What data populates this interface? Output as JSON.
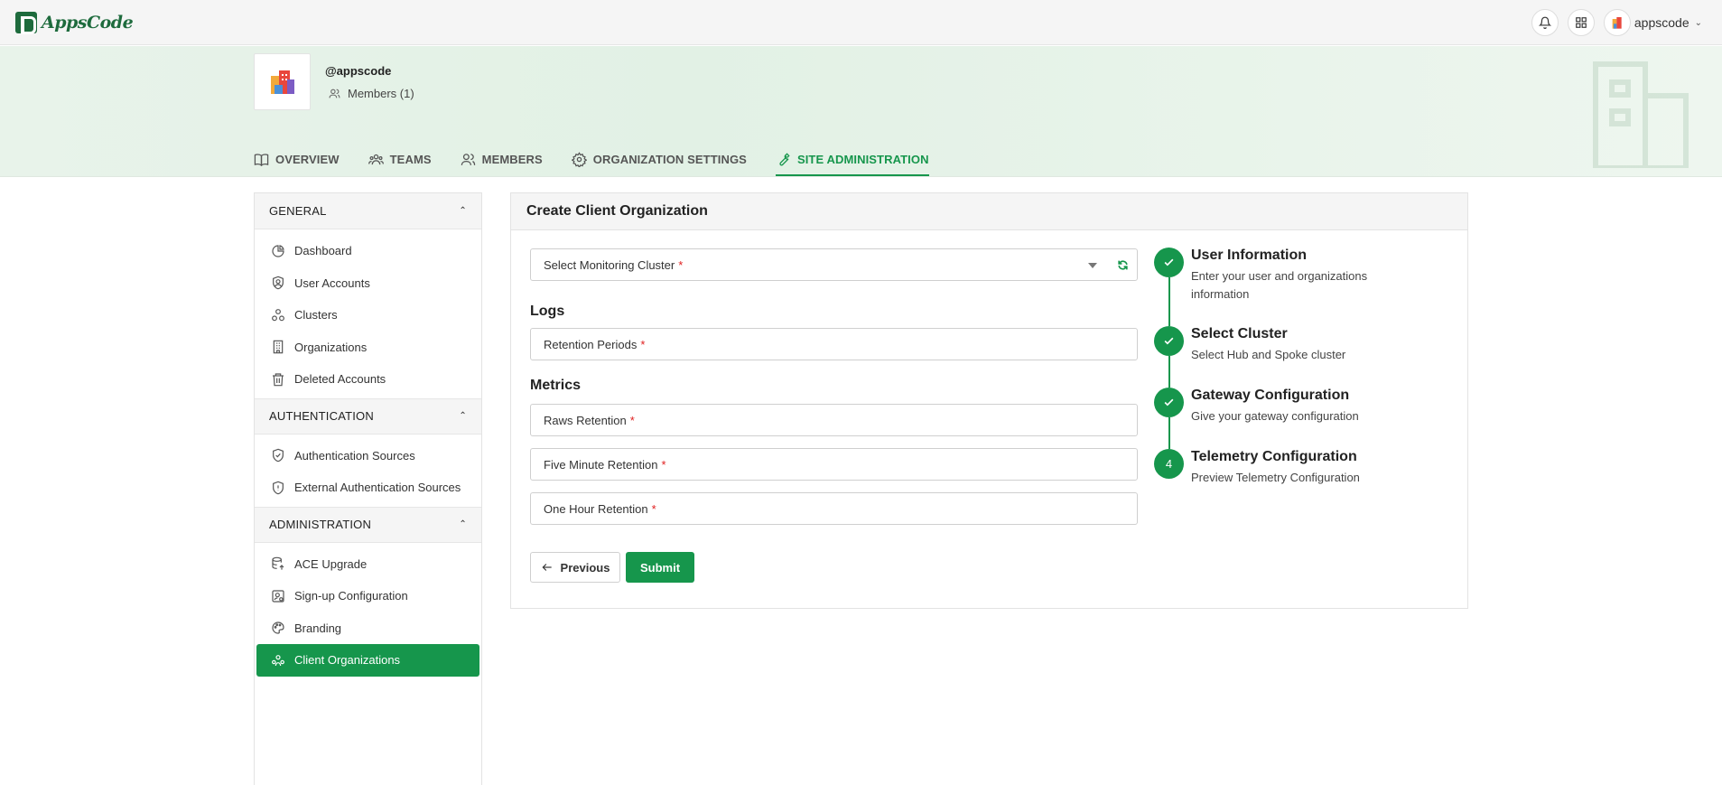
{
  "app": {
    "brand": "AppsCode",
    "user": "appscode"
  },
  "org": {
    "handle": "@appscode",
    "members": "Members (1)"
  },
  "tabs": [
    {
      "label": "OVERVIEW",
      "icon": "book-icon"
    },
    {
      "label": "TEAMS",
      "icon": "teams-icon"
    },
    {
      "label": "MEMBERS",
      "icon": "members-icon"
    },
    {
      "label": "ORGANIZATION SETTINGS",
      "icon": "gear-icon"
    },
    {
      "label": "SITE ADMINISTRATION",
      "icon": "wrench-icon",
      "active": true
    }
  ],
  "sidebar": {
    "general": {
      "title": "GENERAL",
      "items": [
        "Dashboard",
        "User Accounts",
        "Clusters",
        "Organizations",
        "Deleted Accounts"
      ]
    },
    "authentication": {
      "title": "AUTHENTICATION",
      "items": [
        "Authentication Sources",
        "External Authentication Sources"
      ]
    },
    "administration": {
      "title": "ADMINISTRATION",
      "items": [
        "ACE Upgrade",
        "Sign-up Configuration",
        "Branding",
        "Client Organizations"
      ],
      "active": "Client Organizations"
    }
  },
  "form": {
    "title": "Create Client Organization",
    "cluster_select": "Select Monitoring Cluster",
    "logs_label": "Logs",
    "retention_periods": "Retention Periods",
    "metrics_label": "Metrics",
    "raws_retention": "Raws Retention",
    "five_minute_retention": "Five Minute Retention",
    "one_hour_retention": "One Hour Retention",
    "required_mark": "*",
    "previous": "Previous",
    "submit": "Submit"
  },
  "steps": [
    {
      "title": "User Information",
      "desc": "Enter your user and organizations information",
      "status": "done"
    },
    {
      "title": "Select Cluster",
      "desc": "Select Hub and Spoke cluster",
      "status": "done"
    },
    {
      "title": "Gateway Configuration",
      "desc": "Give your gateway configuration",
      "status": "done"
    },
    {
      "title": "Telemetry Configuration",
      "desc": "Preview Telemetry Configuration",
      "status": "current",
      "number": "4"
    }
  ],
  "colors": {
    "accent": "#16964c",
    "brand": "#1e6b3d",
    "required": "#e02020"
  }
}
